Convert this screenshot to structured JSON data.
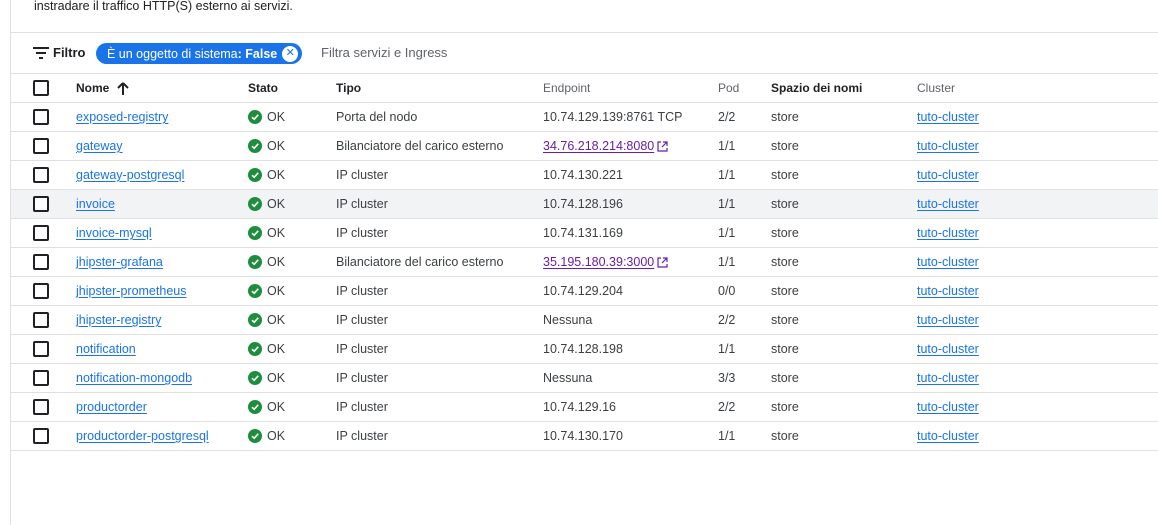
{
  "intro_text": "instradare il traffico HTTP(S) esterno ai servizi.",
  "filter": {
    "label": "Filtro",
    "chip_key": "È un oggetto di sistema",
    "chip_value": ": False",
    "placeholder": "Filtra servizi e Ingress"
  },
  "columns": {
    "name": "Nome",
    "state": "Stato",
    "type": "Tipo",
    "endpoint": "Endpoint",
    "pod": "Pod",
    "namespace": "Spazio dei nomi",
    "cluster": "Cluster"
  },
  "rows": [
    {
      "name": "exposed-registry",
      "state": "OK",
      "type": "Porta del nodo",
      "endpoint": "10.74.129.139:8761 TCP",
      "endpoint_link": false,
      "pod": "2/2",
      "namespace": "store",
      "cluster": "tuto-cluster"
    },
    {
      "name": "gateway",
      "state": "OK",
      "type": "Bilanciatore del carico esterno",
      "endpoint": "34.76.218.214:8080",
      "endpoint_link": true,
      "pod": "1/1",
      "namespace": "store",
      "cluster": "tuto-cluster"
    },
    {
      "name": "gateway-postgresql",
      "state": "OK",
      "type": "IP cluster",
      "endpoint": "10.74.130.221",
      "endpoint_link": false,
      "pod": "1/1",
      "namespace": "store",
      "cluster": "tuto-cluster"
    },
    {
      "name": "invoice",
      "state": "OK",
      "type": "IP cluster",
      "endpoint": "10.74.128.196",
      "endpoint_link": false,
      "pod": "1/1",
      "namespace": "store",
      "cluster": "tuto-cluster"
    },
    {
      "name": "invoice-mysql",
      "state": "OK",
      "type": "IP cluster",
      "endpoint": "10.74.131.169",
      "endpoint_link": false,
      "pod": "1/1",
      "namespace": "store",
      "cluster": "tuto-cluster"
    },
    {
      "name": "jhipster-grafana",
      "state": "OK",
      "type": "Bilanciatore del carico esterno",
      "endpoint": "35.195.180.39:3000",
      "endpoint_link": true,
      "pod": "1/1",
      "namespace": "store",
      "cluster": "tuto-cluster"
    },
    {
      "name": "jhipster-prometheus",
      "state": "OK",
      "type": "IP cluster",
      "endpoint": "10.74.129.204",
      "endpoint_link": false,
      "pod": "0/0",
      "namespace": "store",
      "cluster": "tuto-cluster"
    },
    {
      "name": "jhipster-registry",
      "state": "OK",
      "type": "IP cluster",
      "endpoint": "Nessuna",
      "endpoint_link": false,
      "pod": "2/2",
      "namespace": "store",
      "cluster": "tuto-cluster"
    },
    {
      "name": "notification",
      "state": "OK",
      "type": "IP cluster",
      "endpoint": "10.74.128.198",
      "endpoint_link": false,
      "pod": "1/1",
      "namespace": "store",
      "cluster": "tuto-cluster"
    },
    {
      "name": "notification-mongodb",
      "state": "OK",
      "type": "IP cluster",
      "endpoint": "Nessuna",
      "endpoint_link": false,
      "pod": "3/3",
      "namespace": "store",
      "cluster": "tuto-cluster"
    },
    {
      "name": "productorder",
      "state": "OK",
      "type": "IP cluster",
      "endpoint": "10.74.129.16",
      "endpoint_link": false,
      "pod": "2/2",
      "namespace": "store",
      "cluster": "tuto-cluster"
    },
    {
      "name": "productorder-postgresql",
      "state": "OK",
      "type": "IP cluster",
      "endpoint": "10.74.130.170",
      "endpoint_link": false,
      "pod": "1/1",
      "namespace": "store",
      "cluster": "tuto-cluster"
    }
  ],
  "hovered_row": 3,
  "icons": {
    "filter": "filter-lines-icon",
    "sort": "arrow-up-icon",
    "status": "check-circle-icon",
    "external": "open-in-new-icon",
    "chip_close": "cancel-icon"
  },
  "colors": {
    "accent": "#1a73e8",
    "ok": "#1e8e3e",
    "visited_link": "#681da8"
  }
}
